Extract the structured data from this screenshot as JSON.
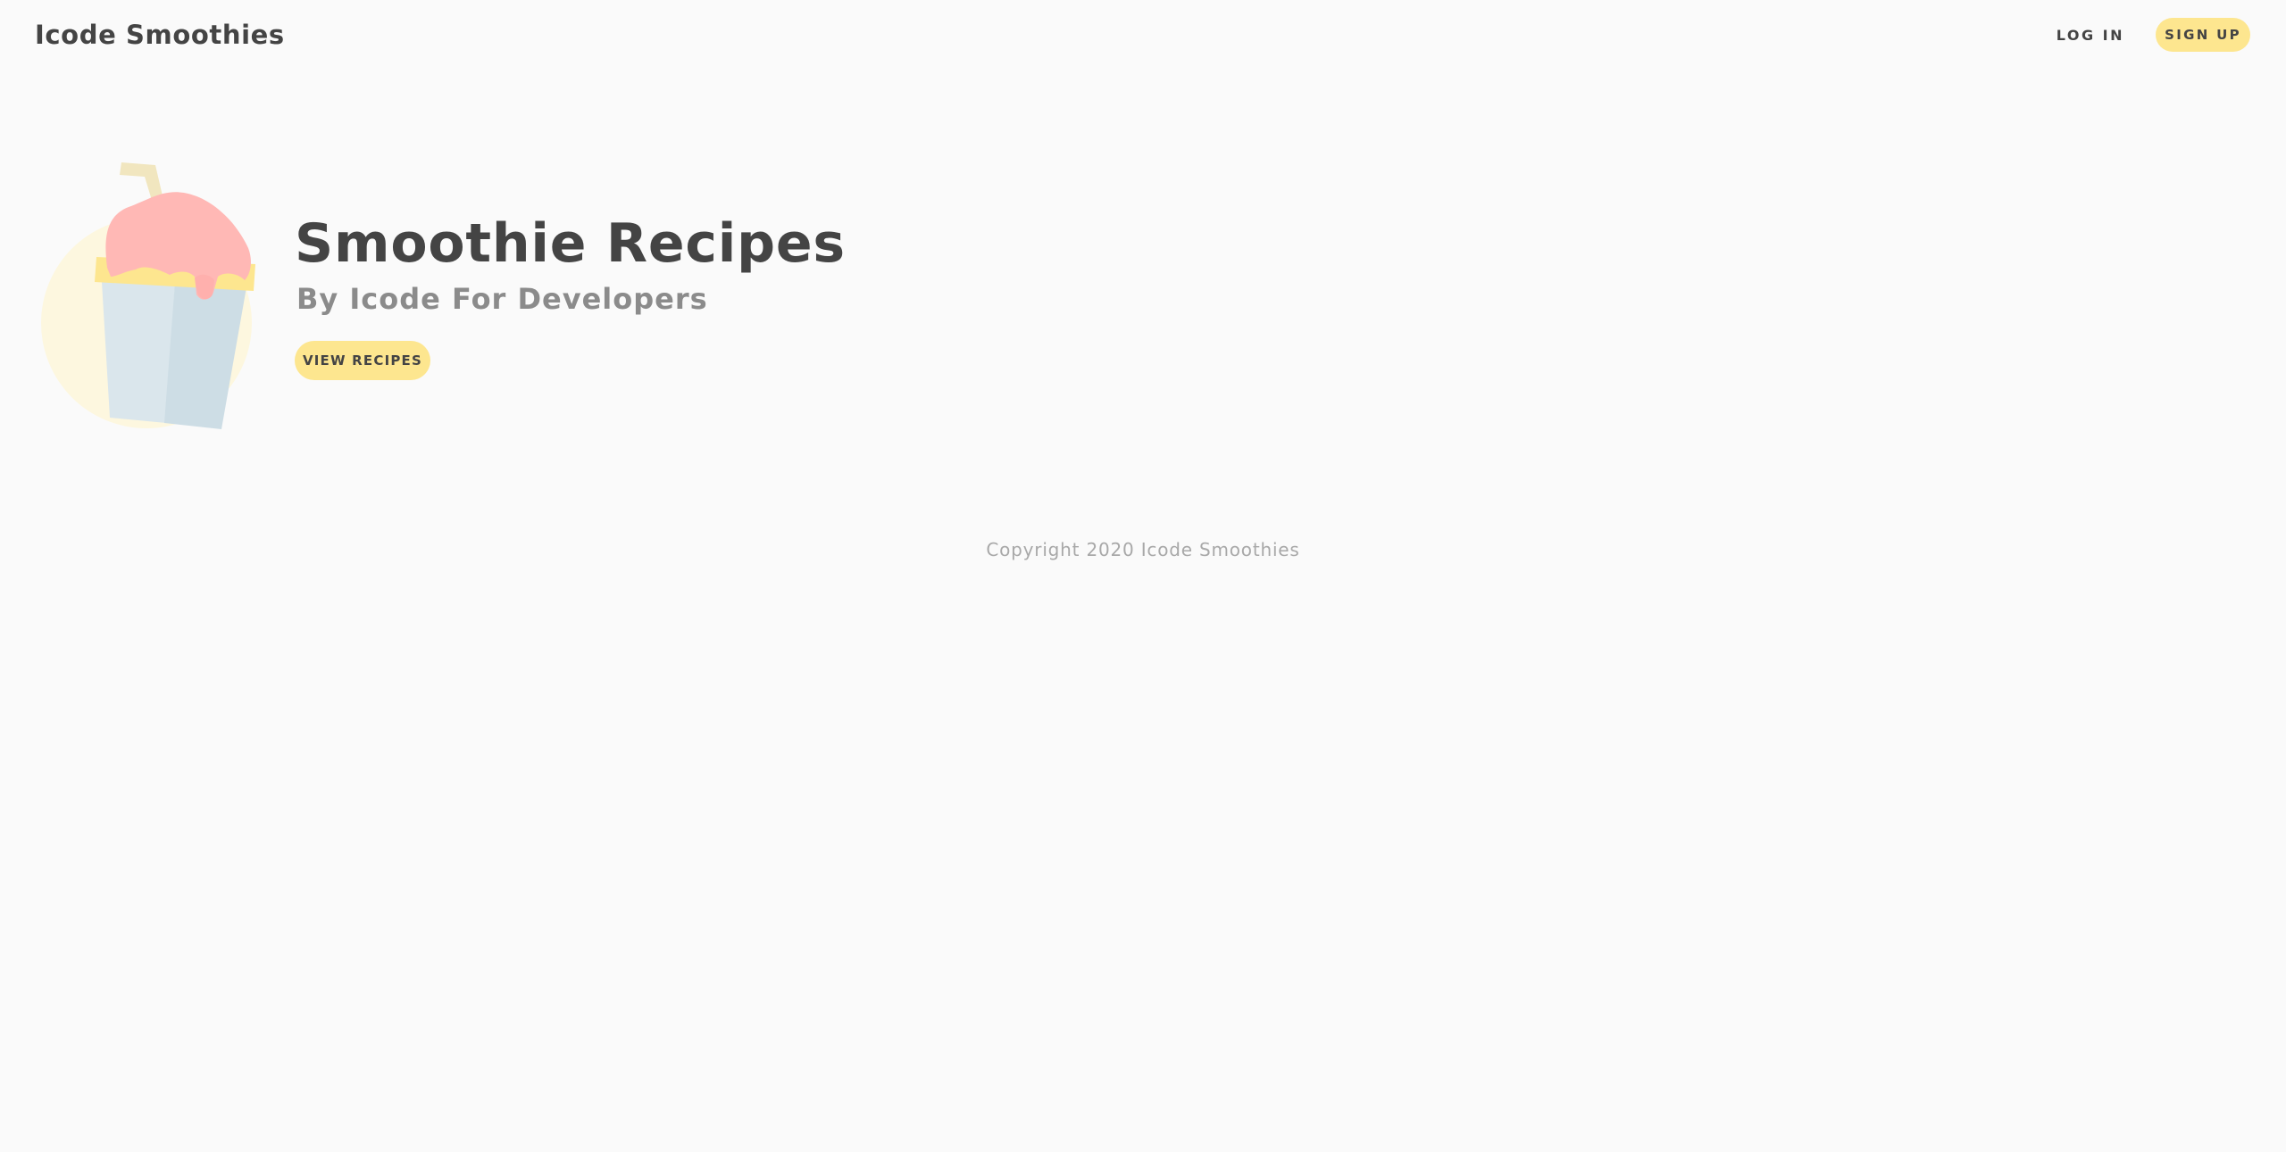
{
  "nav": {
    "brand": "Icode Smoothies",
    "login_label": "LOG IN",
    "signup_label": "SIGN UP"
  },
  "hero": {
    "title": "Smoothie Recipes",
    "subtitle": "By Icode For Developers",
    "cta_label": "VIEW RECIPES",
    "illustration_icon": "smoothie-cup-icon"
  },
  "footer": {
    "copyright": "Copyright 2020 Icode Smoothies"
  },
  "colors": {
    "background": "#fafafa",
    "text": "#444444",
    "muted_text": "#8b8b8b",
    "accent": "#fde68f",
    "smoothie_pink": "#ffb8b5",
    "cup_blue": "#d8e6ec"
  }
}
